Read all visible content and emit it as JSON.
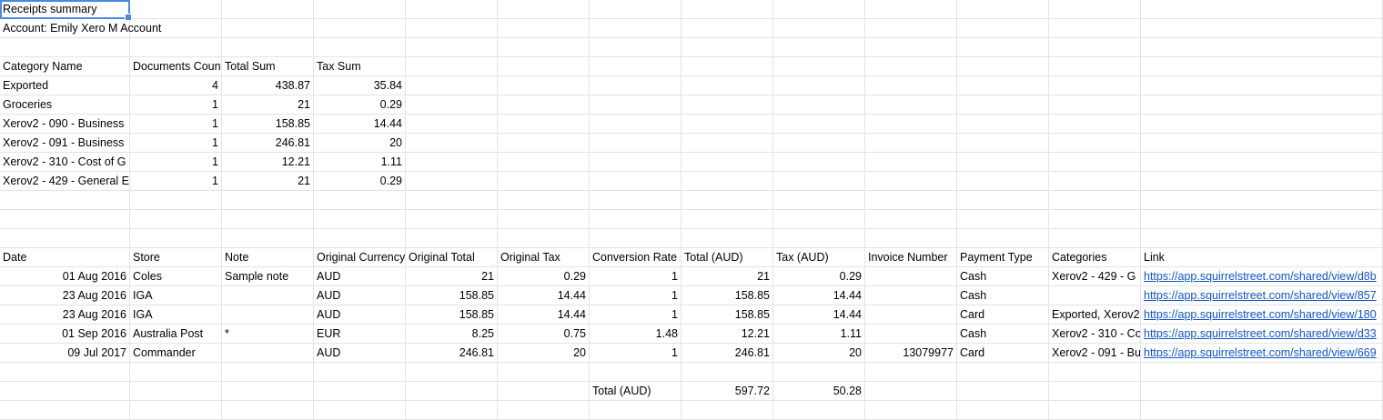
{
  "sheet": {
    "title": "Receipts summary",
    "account": "Account: Emily Xero M Account",
    "summary": {
      "headers": [
        "Category Name",
        "Documents Count",
        "Total Sum",
        "Tax Sum"
      ],
      "rows": [
        [
          "Exported",
          "4",
          "438.87",
          "35.84"
        ],
        [
          "Groceries",
          "1",
          "21",
          "0.29"
        ],
        [
          "Xerov2 - 090 - Business",
          "1",
          "158.85",
          "14.44"
        ],
        [
          "Xerov2 - 091 - Business",
          "1",
          "246.81",
          "20"
        ],
        [
          "Xerov2 - 310 - Cost of G",
          "1",
          "12.21",
          "1.11"
        ],
        [
          "Xerov2 - 429 - General E",
          "1",
          "21",
          "0.29"
        ]
      ]
    },
    "detail": {
      "headers": [
        "Date",
        "Store",
        "Note",
        "Original Currency",
        "Original Total",
        "Original Tax",
        "Conversion Rate",
        "Total (AUD)",
        "Tax (AUD)",
        "Invoice Number",
        "Payment Type",
        "Categories",
        "Link"
      ],
      "rows": [
        [
          "01 Aug 2016",
          "Coles",
          "Sample note",
          "AUD",
          "21",
          "0.29",
          "1",
          "21",
          "0.29",
          "",
          "Cash",
          "Xerov2 - 429 - G",
          "https://app.squirrelstreet.com/shared/view/d8b"
        ],
        [
          "23 Aug 2016",
          "IGA",
          "",
          "AUD",
          "158.85",
          "14.44",
          "1",
          "158.85",
          "14.44",
          "",
          "Cash",
          "",
          "https://app.squirrelstreet.com/shared/view/857"
        ],
        [
          "23 Aug 2016",
          "IGA",
          "",
          "AUD",
          "158.85",
          "14.44",
          "1",
          "158.85",
          "14.44",
          "",
          "Card",
          "Exported, Xerov2",
          "https://app.squirrelstreet.com/shared/view/180"
        ],
        [
          "01 Sep 2016",
          "Australia Post",
          "*",
          "EUR",
          "8.25",
          "0.75",
          "1.48",
          "12.21",
          "1.11",
          "",
          "Cash",
          "Xerov2 - 310 - Co",
          "https://app.squirrelstreet.com/shared/view/d33"
        ],
        [
          "09 Jul 2017",
          "Commander",
          "",
          "AUD",
          "246.81",
          "20",
          "1",
          "246.81",
          "20",
          "13079977",
          "Card",
          "Xerov2 - 091 - Bu",
          "https://app.squirrelstreet.com/shared/view/669"
        ]
      ],
      "total_label": "Total (AUD)",
      "total_aud": "597.72",
      "total_tax": "50.28"
    }
  }
}
